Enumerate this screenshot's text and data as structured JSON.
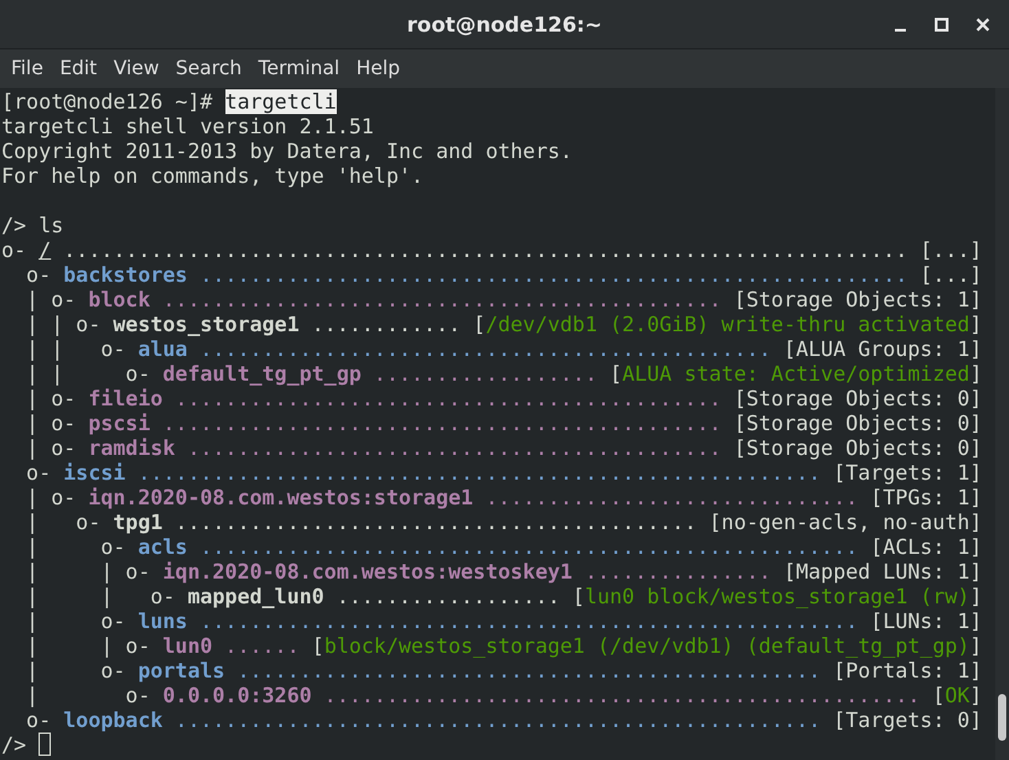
{
  "window": {
    "title": "root@node126:~"
  },
  "menu": [
    "File",
    "Edit",
    "View",
    "Search",
    "Terminal",
    "Help"
  ],
  "terminal": {
    "lines": [
      {
        "kind": "text",
        "segments": [
          {
            "kind": "plain",
            "text": "[root@node126 ~]# "
          },
          {
            "kind": "highlight",
            "text": "targetcli"
          }
        ]
      },
      {
        "kind": "text",
        "segments": [
          {
            "kind": "plain",
            "text": "targetcli shell version 2.1.51"
          }
        ]
      },
      {
        "kind": "text",
        "segments": [
          {
            "kind": "plain",
            "text": "Copyright 2011-2013 by Datera, Inc and others."
          }
        ]
      },
      {
        "kind": "text",
        "segments": [
          {
            "kind": "plain",
            "text": "For help on commands, type 'help'."
          }
        ]
      },
      {
        "kind": "blank"
      },
      {
        "kind": "text",
        "segments": [
          {
            "kind": "plain",
            "text": "/> ls"
          }
        ]
      },
      {
        "kind": "text",
        "segments": [
          {
            "kind": "plain",
            "text": "o- "
          },
          {
            "kind": "underline",
            "text": "/"
          },
          {
            "kind": "plain",
            "text": " .................................................................... [...]"
          }
        ]
      },
      {
        "kind": "text",
        "segments": [
          {
            "kind": "plain",
            "text": "  o- "
          },
          {
            "kind": "blue-name",
            "text": "backstores"
          },
          {
            "kind": "blue-dots",
            "text": " ......................................................... "
          },
          {
            "kind": "plain",
            "text": "[...]"
          }
        ]
      },
      {
        "kind": "text",
        "segments": [
          {
            "kind": "plain",
            "text": "  | o- "
          },
          {
            "kind": "purple-name",
            "text": "block"
          },
          {
            "kind": "purple-dots",
            "text": " ............................................. "
          },
          {
            "kind": "plain",
            "text": "[Storage Objects: 1]"
          }
        ]
      },
      {
        "kind": "text",
        "segments": [
          {
            "kind": "plain",
            "text": "  | | o- "
          },
          {
            "kind": "bold-name",
            "text": "westos_storage1"
          },
          {
            "kind": "plain",
            "text": " ............ ["
          },
          {
            "kind": "green",
            "text": "/dev/vdb1 (2.0GiB) write-thru activated"
          },
          {
            "kind": "plain",
            "text": "]"
          }
        ]
      },
      {
        "kind": "text",
        "segments": [
          {
            "kind": "plain",
            "text": "  | |   o- "
          },
          {
            "kind": "blue-name",
            "text": "alua"
          },
          {
            "kind": "blue-dots",
            "text": " .............................................. "
          },
          {
            "kind": "plain",
            "text": "[ALUA Groups: 1]"
          }
        ]
      },
      {
        "kind": "text",
        "segments": [
          {
            "kind": "plain",
            "text": "  | |     o- "
          },
          {
            "kind": "purple-name",
            "text": "default_tg_pt_gp"
          },
          {
            "kind": "purple-dots",
            "text": " .................. "
          },
          {
            "kind": "plain",
            "text": "["
          },
          {
            "kind": "green",
            "text": "ALUA state: Active/optimized"
          },
          {
            "kind": "plain",
            "text": "]"
          }
        ]
      },
      {
        "kind": "text",
        "segments": [
          {
            "kind": "plain",
            "text": "  | o- "
          },
          {
            "kind": "purple-name",
            "text": "fileio"
          },
          {
            "kind": "purple-dots",
            "text": " ............................................ "
          },
          {
            "kind": "plain",
            "text": "[Storage Objects: 0]"
          }
        ]
      },
      {
        "kind": "text",
        "segments": [
          {
            "kind": "plain",
            "text": "  | o- "
          },
          {
            "kind": "purple-name",
            "text": "pscsi"
          },
          {
            "kind": "purple-dots",
            "text": " ............................................. "
          },
          {
            "kind": "plain",
            "text": "[Storage Objects: 0]"
          }
        ]
      },
      {
        "kind": "text",
        "segments": [
          {
            "kind": "plain",
            "text": "  | o- "
          },
          {
            "kind": "purple-name",
            "text": "ramdisk"
          },
          {
            "kind": "purple-dots",
            "text": " ........................................... "
          },
          {
            "kind": "plain",
            "text": "[Storage Objects: 0]"
          }
        ]
      },
      {
        "kind": "text",
        "segments": [
          {
            "kind": "plain",
            "text": "  o- "
          },
          {
            "kind": "blue-name",
            "text": "iscsi"
          },
          {
            "kind": "blue-dots",
            "text": " ....................................................... "
          },
          {
            "kind": "plain",
            "text": "[Targets: 1]"
          }
        ]
      },
      {
        "kind": "text",
        "segments": [
          {
            "kind": "plain",
            "text": "  | o- "
          },
          {
            "kind": "purple-name",
            "text": "iqn.2020-08.com.westos:storage1"
          },
          {
            "kind": "purple-dots",
            "text": " .............................. "
          },
          {
            "kind": "plain",
            "text": "[TPGs: 1]"
          }
        ]
      },
      {
        "kind": "text",
        "segments": [
          {
            "kind": "plain",
            "text": "  |   o- "
          },
          {
            "kind": "bold-name",
            "text": "tpg1"
          },
          {
            "kind": "plain",
            "text": " .......................................... [no-gen-acls, no-auth]"
          }
        ]
      },
      {
        "kind": "text",
        "segments": [
          {
            "kind": "plain",
            "text": "  |     o- "
          },
          {
            "kind": "blue-name",
            "text": "acls"
          },
          {
            "kind": "blue-dots",
            "text": " ..................................................... "
          },
          {
            "kind": "plain",
            "text": "[ACLs: 1]"
          }
        ]
      },
      {
        "kind": "text",
        "segments": [
          {
            "kind": "plain",
            "text": "  |     | o- "
          },
          {
            "kind": "purple-name",
            "text": "iqn.2020-08.com.westos:westoskey1"
          },
          {
            "kind": "purple-dots",
            "text": " ............... "
          },
          {
            "kind": "plain",
            "text": "[Mapped LUNs: 1]"
          }
        ]
      },
      {
        "kind": "text",
        "segments": [
          {
            "kind": "plain",
            "text": "  |     |   o- "
          },
          {
            "kind": "bold-name",
            "text": "mapped_lun0"
          },
          {
            "kind": "plain",
            "text": " .................. ["
          },
          {
            "kind": "green",
            "text": "lun0 block/westos_storage1 (rw)"
          },
          {
            "kind": "plain",
            "text": "]"
          }
        ]
      },
      {
        "kind": "text",
        "segments": [
          {
            "kind": "plain",
            "text": "  |     o- "
          },
          {
            "kind": "blue-name",
            "text": "luns"
          },
          {
            "kind": "blue-dots",
            "text": " ..................................................... "
          },
          {
            "kind": "plain",
            "text": "[LUNs: 1]"
          }
        ]
      },
      {
        "kind": "text",
        "segments": [
          {
            "kind": "plain",
            "text": "  |     | o- "
          },
          {
            "kind": "purple-name",
            "text": "lun0"
          },
          {
            "kind": "purple-dots",
            "text": " ...... "
          },
          {
            "kind": "plain",
            "text": "["
          },
          {
            "kind": "green",
            "text": "block/westos_storage1 (/dev/vdb1) (default_tg_pt_gp)"
          },
          {
            "kind": "plain",
            "text": "]"
          }
        ]
      },
      {
        "kind": "text",
        "segments": [
          {
            "kind": "plain",
            "text": "  |     o- "
          },
          {
            "kind": "blue-name",
            "text": "portals"
          },
          {
            "kind": "blue-dots",
            "text": " ............................................... "
          },
          {
            "kind": "plain",
            "text": "[Portals: 1]"
          }
        ]
      },
      {
        "kind": "text",
        "segments": [
          {
            "kind": "plain",
            "text": "  |       o- "
          },
          {
            "kind": "purple-name",
            "text": "0.0.0.0:3260"
          },
          {
            "kind": "purple-dots",
            "text": " ................................................ "
          },
          {
            "kind": "plain",
            "text": "["
          },
          {
            "kind": "green",
            "text": "OK"
          },
          {
            "kind": "plain",
            "text": "]"
          }
        ]
      },
      {
        "kind": "text",
        "segments": [
          {
            "kind": "plain",
            "text": "  o- "
          },
          {
            "kind": "blue-name",
            "text": "loopback"
          },
          {
            "kind": "blue-dots",
            "text": " .................................................... "
          },
          {
            "kind": "plain",
            "text": "[Targets: 0]"
          }
        ]
      },
      {
        "kind": "prompt",
        "cursor": true,
        "segments": [
          {
            "kind": "plain",
            "text": "/> "
          }
        ]
      }
    ]
  }
}
